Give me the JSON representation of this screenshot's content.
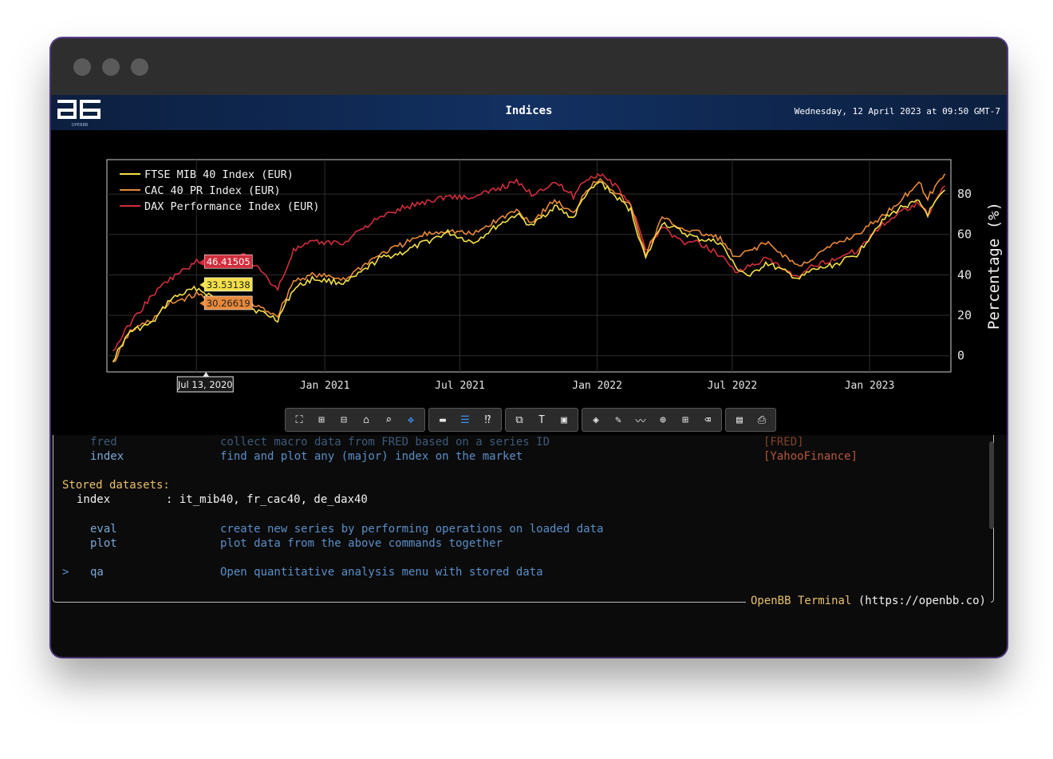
{
  "app": {
    "title": "Indices",
    "datetime": "Wednesday, 12 April 2023 at 09:50 GMT-7",
    "logo_text": "OPENBB"
  },
  "colors": {
    "ftse": "#f3e04a",
    "cac": "#e8893a",
    "dax": "#d12e3c",
    "accent": "#3b8ef0"
  },
  "chart_data": {
    "type": "line",
    "ylabel": "Percentage (%)",
    "ylim": [
      -8,
      97
    ],
    "yticks": [
      0,
      20,
      40,
      60,
      80
    ],
    "xticks": [
      "Jan 2021",
      "Jul 2021",
      "Jan 2022",
      "Jul 2022",
      "Jan 2023"
    ],
    "grid": true,
    "legend_position": "top-left",
    "hover": {
      "x_label": "Jul 13, 2020",
      "values": [
        "46.41505",
        "33.53138",
        "30.26619"
      ]
    },
    "series": [
      {
        "name": "FTSE MIB 40 Index (EUR)",
        "x": [
          "2020-03-23",
          "2020-04-15",
          "2020-05-15",
          "2020-06-08",
          "2020-07-13",
          "2020-08-15",
          "2020-09-15",
          "2020-10-30",
          "2020-11-20",
          "2020-12-15",
          "2021-01-29",
          "2021-02-15",
          "2021-03-15",
          "2021-04-15",
          "2021-05-15",
          "2021-06-15",
          "2021-07-19",
          "2021-08-15",
          "2021-09-15",
          "2021-10-05",
          "2021-11-05",
          "2021-11-30",
          "2021-12-15",
          "2022-01-05",
          "2022-01-25",
          "2022-02-15",
          "2022-03-07",
          "2022-03-29",
          "2022-04-25",
          "2022-05-15",
          "2022-06-15",
          "2022-07-05",
          "2022-07-25",
          "2022-08-15",
          "2022-09-29",
          "2022-10-15",
          "2022-11-15",
          "2022-12-15",
          "2023-01-15",
          "2023-02-15",
          "2023-03-08",
          "2023-03-20",
          "2023-04-12"
        ],
        "values": [
          -2,
          12,
          16,
          28,
          33.5,
          27,
          25,
          18,
          33,
          38,
          36,
          40,
          48,
          51,
          56,
          61,
          56,
          63,
          70,
          64,
          74,
          68,
          79,
          86,
          79,
          72,
          48,
          66,
          61,
          58,
          56,
          44,
          39,
          46,
          38,
          42,
          45,
          50,
          66,
          74,
          76,
          70,
          82
        ]
      },
      {
        "name": "CAC 40 PR Index (EUR)",
        "x": [
          "2020-03-23",
          "2020-04-15",
          "2020-05-15",
          "2020-06-08",
          "2020-07-13",
          "2020-08-15",
          "2020-09-15",
          "2020-10-30",
          "2020-11-20",
          "2020-12-15",
          "2021-01-29",
          "2021-02-15",
          "2021-03-15",
          "2021-04-15",
          "2021-05-15",
          "2021-06-15",
          "2021-07-19",
          "2021-08-15",
          "2021-09-15",
          "2021-10-05",
          "2021-11-05",
          "2021-11-30",
          "2021-12-15",
          "2022-01-05",
          "2022-01-25",
          "2022-02-15",
          "2022-03-07",
          "2022-03-29",
          "2022-04-25",
          "2022-05-15",
          "2022-06-15",
          "2022-07-05",
          "2022-07-25",
          "2022-08-15",
          "2022-09-29",
          "2022-10-15",
          "2022-11-15",
          "2022-12-15",
          "2023-01-15",
          "2023-02-15",
          "2023-03-08",
          "2023-03-20",
          "2023-04-12"
        ],
        "values": [
          -4,
          12,
          18,
          26,
          30.3,
          27,
          27,
          20,
          37,
          40,
          38,
          43,
          50,
          55,
          60,
          62,
          60,
          66,
          72,
          66,
          77,
          70,
          81,
          88,
          81,
          74,
          50,
          68,
          63,
          61,
          58,
          48,
          52,
          56,
          44,
          48,
          55,
          60,
          68,
          78,
          86,
          78,
          90
        ]
      },
      {
        "name": "DAX Performance Index (EUR)",
        "x": [
          "2020-03-23",
          "2020-04-15",
          "2020-05-15",
          "2020-06-08",
          "2020-07-13",
          "2020-08-15",
          "2020-09-15",
          "2020-10-30",
          "2020-11-20",
          "2020-12-15",
          "2021-01-29",
          "2021-02-15",
          "2021-03-15",
          "2021-04-15",
          "2021-05-15",
          "2021-06-15",
          "2021-07-19",
          "2021-08-15",
          "2021-09-15",
          "2021-10-05",
          "2021-11-05",
          "2021-11-30",
          "2021-12-15",
          "2022-01-05",
          "2022-01-25",
          "2022-02-15",
          "2022-03-07",
          "2022-03-29",
          "2022-04-25",
          "2022-05-15",
          "2022-06-15",
          "2022-07-05",
          "2022-07-25",
          "2022-08-15",
          "2022-09-29",
          "2022-10-15",
          "2022-11-15",
          "2022-12-15",
          "2023-01-15",
          "2023-02-15",
          "2023-03-08",
          "2023-03-20",
          "2023-04-12"
        ],
        "values": [
          2,
          16,
          30,
          38,
          46.4,
          45,
          50,
          33,
          52,
          56,
          56,
          62,
          68,
          73,
          76,
          79,
          78,
          82,
          86,
          80,
          86,
          79,
          87,
          90,
          84,
          75,
          52,
          64,
          56,
          56,
          50,
          42,
          44,
          48,
          38,
          44,
          48,
          52,
          64,
          72,
          76,
          70,
          84
        ]
      }
    ]
  },
  "toolbar": {
    "groups": [
      [
        "autoscale-icon",
        "zoom-in-icon",
        "zoom-out-icon",
        "reset-axes-icon",
        "zoom-icon",
        "pan-icon"
      ],
      [
        "spike-lines-icon",
        "hover-compare-icon",
        "hover-closest-icon"
      ],
      [
        "add-chart-icon",
        "add-text-icon",
        "add-text-box-icon"
      ],
      [
        "draw-color-icon",
        "draw-line-icon",
        "draw-open-path-icon",
        "draw-circle-icon",
        "draw-rect-icon",
        "erase-shape-icon"
      ],
      [
        "export-csv-icon",
        "download-image-icon"
      ]
    ]
  },
  "terminal": {
    "rows_top": [
      {
        "cmd": "fred",
        "desc": "collect macro data from FRED based on a series ID",
        "source": "[FRED]"
      },
      {
        "cmd": "index",
        "desc": "find and plot any (major) index on the market",
        "source": "[YahooFinance]"
      }
    ],
    "stored_title": "Stored datasets:",
    "stored_key": "index",
    "stored_value": ": it_mib40, fr_cac40, de_dax40",
    "rows_mid": [
      {
        "cmd": "eval",
        "desc": "create new series by performing operations on loaded data"
      },
      {
        "cmd": "plot",
        "desc": "plot data from the above commands together"
      }
    ],
    "menu_marker": ">",
    "menu_cmd": "qa",
    "menu_desc": "Open quantitative analysis menu with stored data",
    "footer_brand": "OpenBB Terminal",
    "footer_url": "(https://openbb.co)"
  }
}
